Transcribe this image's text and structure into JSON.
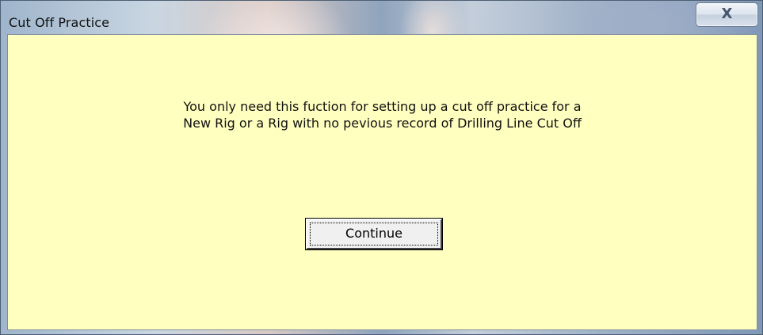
{
  "window": {
    "title": "Cut Off Practice",
    "close_glyph": "X",
    "close_icon": "close-icon"
  },
  "dialog": {
    "background_color": "#ffffc0",
    "message_lines": [
      "You only need this fuction for setting up a cut off practice for a",
      "New Rig or a Rig with no pevious record of Drilling Line Cut Off"
    ],
    "continue_label": "Continue"
  }
}
